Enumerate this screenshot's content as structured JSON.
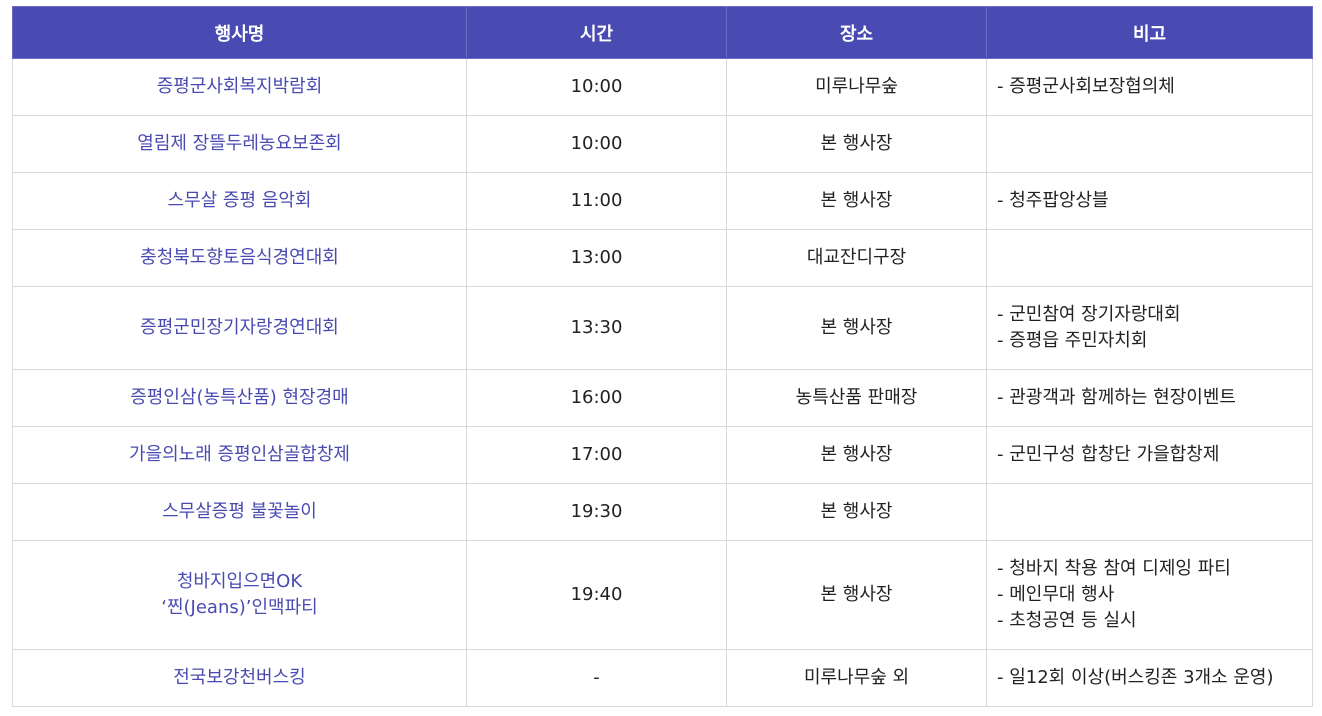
{
  "headers": [
    "행사명",
    "시간",
    "장소",
    "비고"
  ],
  "rows": [
    {
      "name": [
        "증평군사회복지박람회"
      ],
      "time": "10:00",
      "place": "미루나무숲",
      "note": [
        "- 증평군사회보장협의체"
      ]
    },
    {
      "name": [
        "열림제 장뜰두레농요보존회"
      ],
      "time": "10:00",
      "place": "본 행사장",
      "note": []
    },
    {
      "name": [
        "스무살 증평 음악회"
      ],
      "time": "11:00",
      "place": "본 행사장",
      "note": [
        "- 청주팝앙상블"
      ]
    },
    {
      "name": [
        "충청북도향토음식경연대회"
      ],
      "time": "13:00",
      "place": "대교잔디구장",
      "note": []
    },
    {
      "name": [
        "증평군민장기자랑경연대회"
      ],
      "time": "13:30",
      "place": "본 행사장",
      "note": [
        "- 군민참여 장기자랑대회",
        "- 증평읍 주민자치회"
      ]
    },
    {
      "name": [
        "증평인삼(농특산품) 현장경매"
      ],
      "time": "16:00",
      "place": "농특산품 판매장",
      "note": [
        "- 관광객과 함께하는 현장이벤트"
      ]
    },
    {
      "name": [
        "가을의노래 증평인삼골합창제"
      ],
      "time": "17:00",
      "place": "본 행사장",
      "note": [
        "- 군민구성 합창단 가을합창제"
      ]
    },
    {
      "name": [
        "스무살증평 불꽃놀이"
      ],
      "time": "19:30",
      "place": "본 행사장",
      "note": []
    },
    {
      "name": [
        "청바지입으면OK",
        "‘찐(Jeans)’인맥파티"
      ],
      "time": "19:40",
      "place": "본 행사장",
      "note": [
        "- 청바지 착용 참여 디제잉 파티",
        "- 메인무대 행사",
        "- 초청공연 등 실시"
      ]
    },
    {
      "name": [
        "전국보강천버스킹"
      ],
      "time": "-",
      "place": "미루나무숲 외",
      "note": [
        "- 일12회 이상(버스킹존 3개소 운영)"
      ]
    }
  ],
  "colors": {
    "header_bg": "#4a4bb2",
    "name_text": "#4a4bb2",
    "border": "#d9d9d9"
  }
}
